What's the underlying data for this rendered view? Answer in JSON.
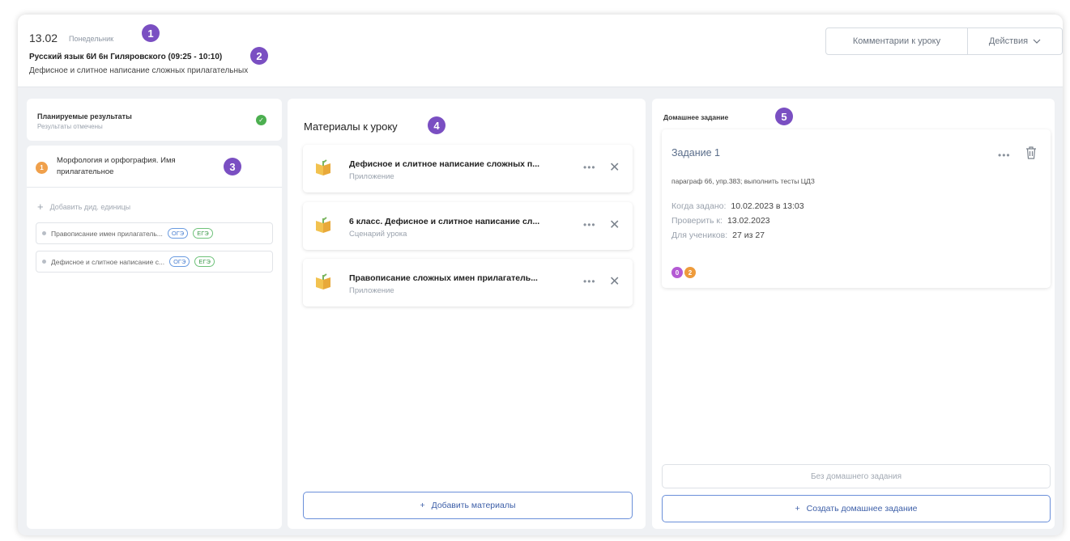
{
  "header": {
    "date": "13.02",
    "day": "Понедельник",
    "lesson": "Русский язык 6И 6н Гиляровского (09:25 - 10:10)",
    "topic": "Дефисное и слитное написание сложных прилагательных",
    "comments_button": "Комментарии к уроку",
    "actions_button": "Действия"
  },
  "markers": [
    "1",
    "2",
    "3",
    "4",
    "5"
  ],
  "left": {
    "planned_title": "Планируемые результаты",
    "planned_sub": "Результаты отмечены",
    "morph_number": "1",
    "morph_title": "Морфология и орфография. Имя прилагательное",
    "add_units": "Добавить дид. единицы",
    "units": [
      {
        "label": "Правописание имен прилагатель...",
        "tag1": "ОГЭ",
        "tag2": "ЕГЭ"
      },
      {
        "label": "Дефисное и слитное написание с...",
        "tag1": "ОГЭ",
        "tag2": "ЕГЭ"
      }
    ]
  },
  "middle": {
    "title": "Материалы к уроку",
    "materials": [
      {
        "title": "Дефисное и слитное написание сложных п...",
        "type": "Приложение"
      },
      {
        "title": "6 класс. Дефисное и слитное написание сл...",
        "type": "Сценарий урока"
      },
      {
        "title": "Правописание сложных имен прилагатель...",
        "type": "Приложение"
      }
    ],
    "add_button": "Добавить материалы"
  },
  "right": {
    "title": "Домашнее задание",
    "task_name": "Задание 1",
    "task_desc": "параграф 66, упр.383; выполнить тесты ЦДЗ",
    "assigned_label": "Когда задано:",
    "assigned_value": "10.02.2023 в 13:03",
    "check_label": "Проверить к:",
    "check_value": "13.02.2023",
    "students_label": "Для учеников:",
    "students_value": "27 из 27",
    "badge1": "0",
    "badge2": "2",
    "no_hw_button": "Без домашнего задания",
    "create_button": "Создать домашнее задание"
  },
  "colors": {
    "accent": "#3d5fa8",
    "marker": "#7a4fc2",
    "success": "#4caf50",
    "badge_purple": "#b45ad4",
    "badge_orange": "#ee9b3c"
  }
}
